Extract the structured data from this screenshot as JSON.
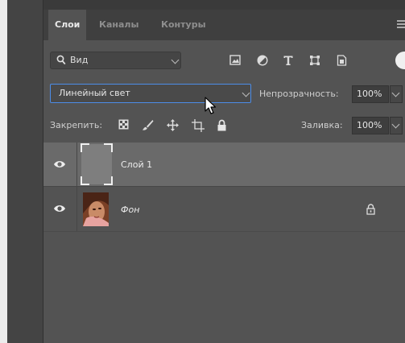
{
  "tabs": [
    {
      "label": "Слои",
      "active": true
    },
    {
      "label": "Каналы",
      "active": false
    },
    {
      "label": "Контуры",
      "active": false
    }
  ],
  "filter": {
    "label": "Вид"
  },
  "filter_icons": [
    "image-filter-icon",
    "adjustment-filter-icon",
    "type-filter-icon",
    "shape-filter-icon",
    "smart-object-filter-icon"
  ],
  "blend": {
    "mode": "Линейный свет"
  },
  "opacity": {
    "label": "Непрозрачность:",
    "value": "100%"
  },
  "lock": {
    "label": "Закрепить:",
    "icons": [
      "lock-transparent-pixels-icon",
      "lock-image-pixels-icon",
      "lock-position-icon",
      "lock-artboard-icon",
      "lock-all-icon"
    ]
  },
  "fill": {
    "label": "Заливка:",
    "value": "100%"
  },
  "layers": [
    {
      "name": "Слой 1",
      "visible": true,
      "selected": true,
      "thumbnail": "gray-fill"
    },
    {
      "name": "Фон",
      "visible": true,
      "selected": false,
      "locked": true,
      "thumbnail": "portrait-photo"
    }
  ],
  "colors": {
    "accent": "#4c8de8",
    "panel": "#535353",
    "selected_row": "#6a6a6a"
  }
}
